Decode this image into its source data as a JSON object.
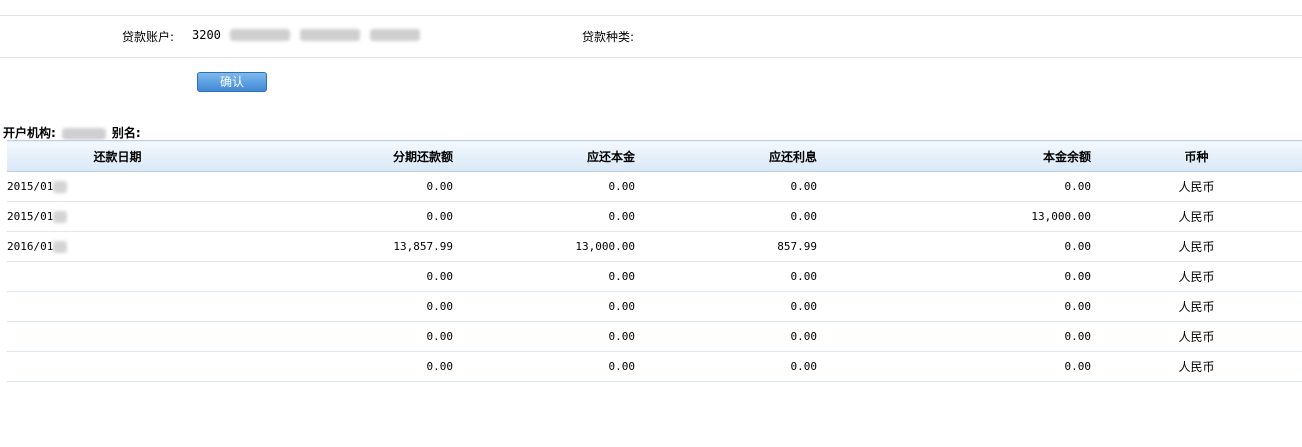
{
  "form": {
    "account_label": "贷款账户:",
    "account_value": "3200",
    "type_label": "贷款种类:",
    "confirm_button": "确认"
  },
  "org": {
    "label": "开户机构:",
    "alias_label": "别名:"
  },
  "table": {
    "headers": [
      "还款日期",
      "分期还款额",
      "应还本金",
      "应还利息",
      "本金余额",
      "币种"
    ],
    "rows": [
      {
        "date": "2015/01",
        "amount": "0.00",
        "principal": "0.00",
        "interest": "0.00",
        "balance": "0.00",
        "currency": "人民币"
      },
      {
        "date": "2015/01",
        "amount": "0.00",
        "principal": "0.00",
        "interest": "0.00",
        "balance": "13,000.00",
        "currency": "人民币"
      },
      {
        "date": "2016/01",
        "amount": "13,857.99",
        "principal": "13,000.00",
        "interest": "857.99",
        "balance": "0.00",
        "currency": "人民币"
      },
      {
        "date": "",
        "amount": "0.00",
        "principal": "0.00",
        "interest": "0.00",
        "balance": "0.00",
        "currency": "人民币"
      },
      {
        "date": "",
        "amount": "0.00",
        "principal": "0.00",
        "interest": "0.00",
        "balance": "0.00",
        "currency": "人民币"
      },
      {
        "date": "",
        "amount": "0.00",
        "principal": "0.00",
        "interest": "0.00",
        "balance": "0.00",
        "currency": "人民币"
      },
      {
        "date": "",
        "amount": "0.00",
        "principal": "0.00",
        "interest": "0.00",
        "balance": "0.00",
        "currency": "人民币"
      }
    ]
  }
}
